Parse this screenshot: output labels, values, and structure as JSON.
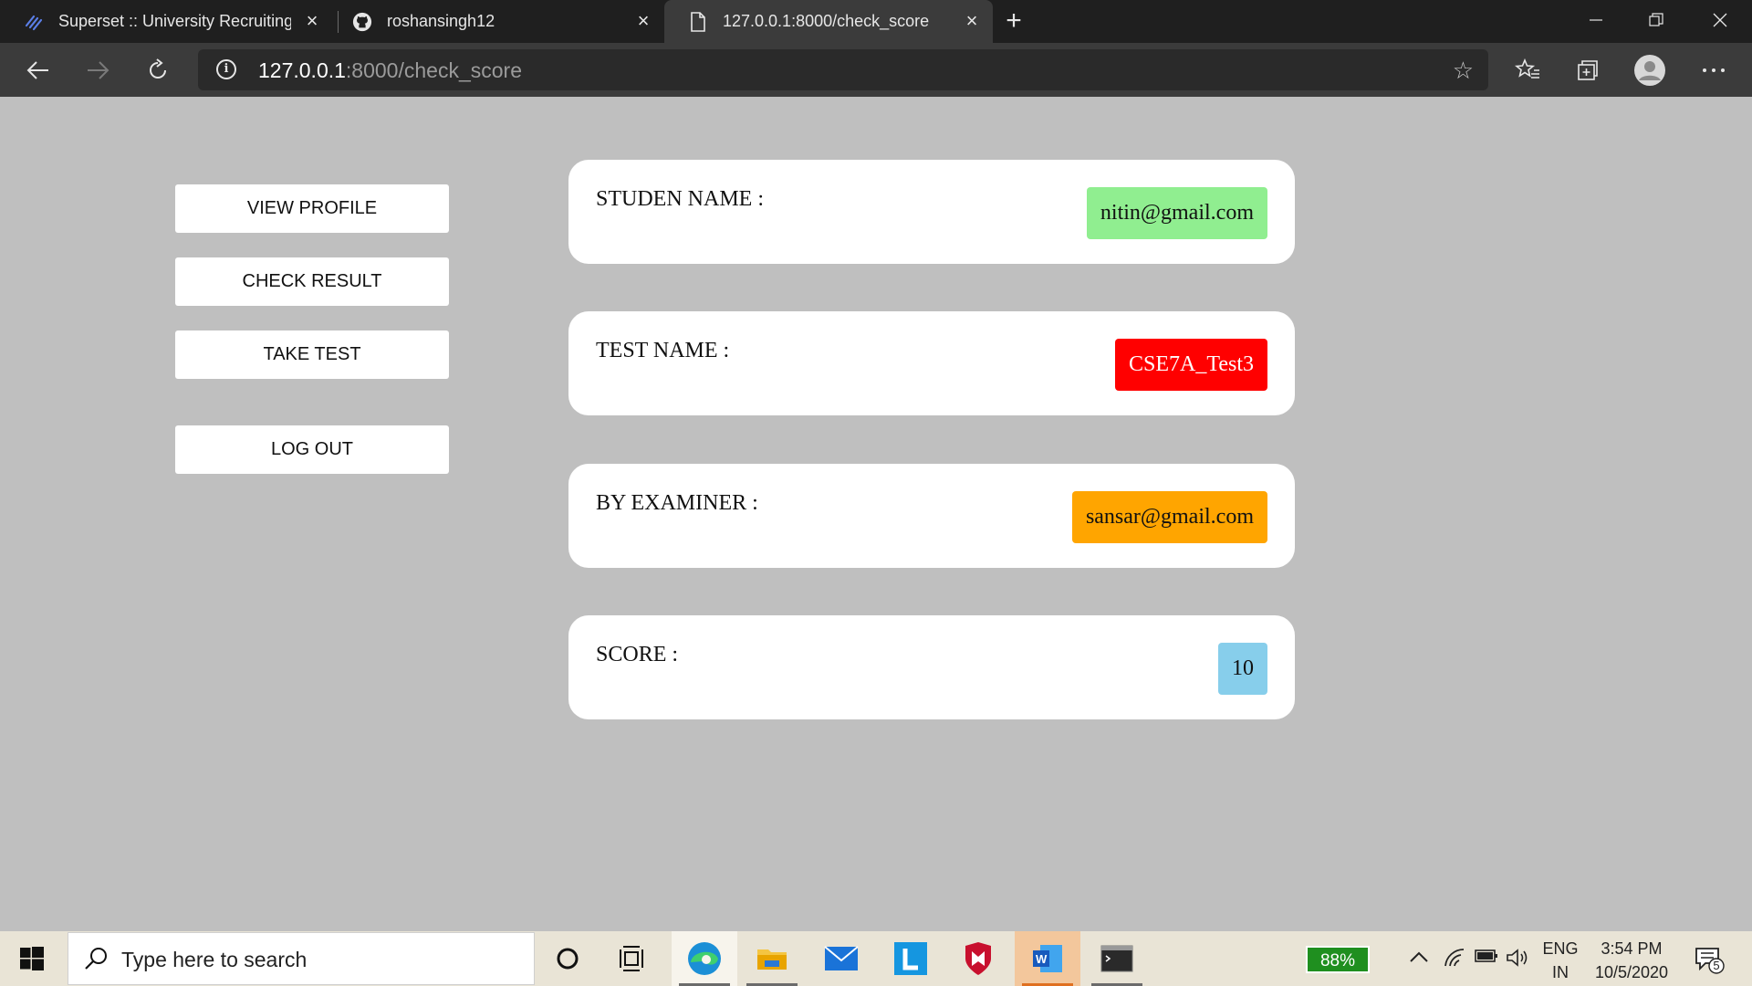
{
  "browser": {
    "tabs": [
      {
        "title": "Superset :: University Recruiting",
        "icon": "superset-icon"
      },
      {
        "title": "roshansingh12",
        "icon": "github-icon"
      },
      {
        "title": "127.0.0.1:8000/check_score",
        "icon": "page-icon",
        "active": true
      }
    ],
    "url_host": "127.0.0.1",
    "url_path": ":8000/check_score"
  },
  "sidebar": {
    "view_profile": "VIEW PROFILE",
    "check_result": "CHECK RESULT",
    "take_test": "TAKE TEST",
    "log_out": "LOG OUT"
  },
  "cards": [
    {
      "label": "STUDEN NAME :",
      "value": "nitin@gmail.com",
      "color": "#90ee90"
    },
    {
      "label": "TEST NAME :",
      "value": "CSE7A_Test3",
      "color": "#ff0000"
    },
    {
      "label": "BY EXAMINER :",
      "value": "sansar@gmail.com",
      "color": "#ffa500"
    },
    {
      "label": "SCORE :",
      "value": "10",
      "color": "#87ceeb"
    }
  ],
  "taskbar": {
    "search_placeholder": "Type here to search",
    "battery": "88%",
    "lang_top": "ENG",
    "lang_bottom": "IN",
    "time": "3:54 PM",
    "date": "10/5/2020",
    "notification_count": "5"
  }
}
